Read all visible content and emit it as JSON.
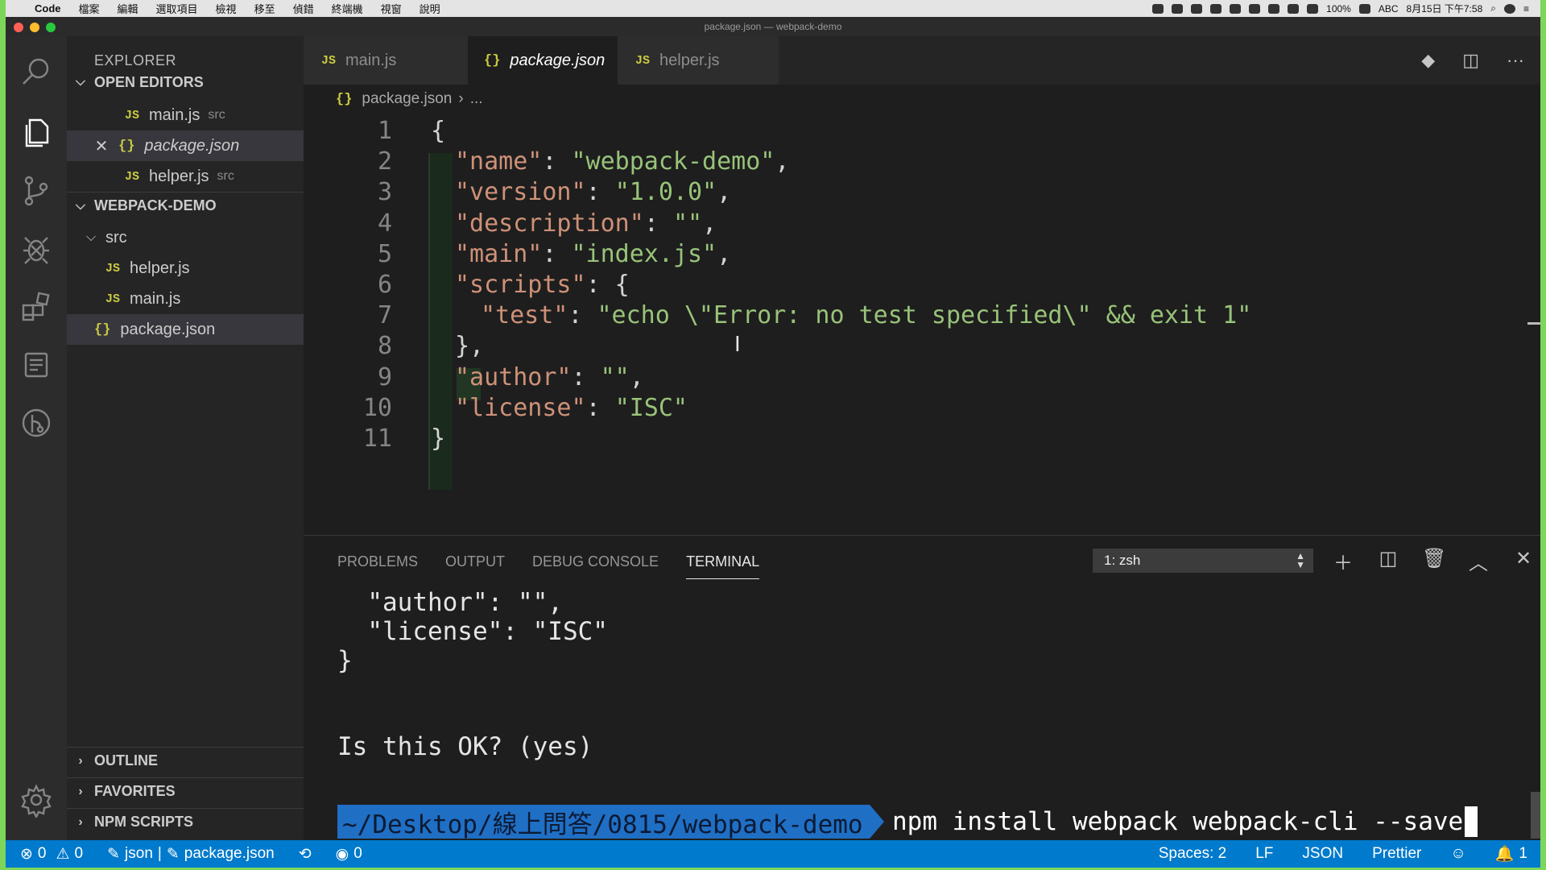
{
  "menubar": {
    "apple": "",
    "items": [
      "Code",
      "檔案",
      "編輯",
      "選取項目",
      "檢視",
      "移至",
      "偵錯",
      "終端機",
      "視窗",
      "說明"
    ],
    "battery": "100%",
    "input": "ABC",
    "datetime": "8月15日 下午7:58"
  },
  "window": {
    "title": "package.json — webpack-demo"
  },
  "sidebar": {
    "title": "EXPLORER",
    "open_editors": {
      "header": "OPEN EDITORS",
      "items": [
        {
          "icon": "JS",
          "name": "main.js",
          "hint": "src"
        },
        {
          "icon": "{}",
          "name": "package.json",
          "hint": ""
        },
        {
          "icon": "JS",
          "name": "helper.js",
          "hint": "src"
        }
      ]
    },
    "project": {
      "header": "WEBPACK-DEMO",
      "folder": "src",
      "files": [
        {
          "icon": "JS",
          "name": "helper.js"
        },
        {
          "icon": "JS",
          "name": "main.js"
        },
        {
          "icon": "{}",
          "name": "package.json"
        }
      ]
    },
    "bottom_sections": [
      "OUTLINE",
      "FAVORITES",
      "NPM SCRIPTS"
    ]
  },
  "tabs": [
    {
      "icon": "JS",
      "label": "main.js",
      "active": false
    },
    {
      "icon": "{}",
      "label": "package.json",
      "active": true
    },
    {
      "icon": "JS",
      "label": "helper.js",
      "active": false
    }
  ],
  "breadcrumb": {
    "icon": "{}",
    "file": "package.json",
    "rest": "..."
  },
  "editor": {
    "line_numbers": [
      "1",
      "2",
      "3",
      "4",
      "5",
      "6",
      "7",
      "8",
      "9",
      "10",
      "11"
    ],
    "lines": [
      {
        "parts": [
          [
            "p",
            "{"
          ]
        ]
      },
      {
        "parts": [
          [
            "k",
            "\"name\""
          ],
          [
            "p",
            ": "
          ],
          [
            "s",
            "\"webpack-demo\""
          ],
          [
            "p",
            ","
          ]
        ]
      },
      {
        "parts": [
          [
            "k",
            "\"version\""
          ],
          [
            "p",
            ": "
          ],
          [
            "s",
            "\"1.0.0\""
          ],
          [
            "p",
            ","
          ]
        ]
      },
      {
        "parts": [
          [
            "k",
            "\"description\""
          ],
          [
            "p",
            ": "
          ],
          [
            "s",
            "\"\""
          ],
          [
            "p",
            ","
          ]
        ]
      },
      {
        "parts": [
          [
            "k",
            "\"main\""
          ],
          [
            "p",
            ": "
          ],
          [
            "s",
            "\"index.js\""
          ],
          [
            "p",
            ","
          ]
        ]
      },
      {
        "parts": [
          [
            "k",
            "\"scripts\""
          ],
          [
            "p",
            ": {"
          ]
        ]
      },
      {
        "parts": [
          [
            "k",
            "\"test\""
          ],
          [
            "p",
            ": "
          ],
          [
            "s",
            "\"echo \\\"Error: no test specified\\\" && exit 1\""
          ]
        ]
      },
      {
        "parts": [
          [
            "p",
            "},"
          ]
        ]
      },
      {
        "parts": [
          [
            "k",
            "\"author\""
          ],
          [
            "p",
            ": "
          ],
          [
            "s",
            "\"\""
          ],
          [
            "p",
            ","
          ]
        ]
      },
      {
        "parts": [
          [
            "k",
            "\"license\""
          ],
          [
            "p",
            ": "
          ],
          [
            "s",
            "\"ISC\""
          ]
        ]
      },
      {
        "parts": [
          [
            "p",
            "}"
          ]
        ]
      }
    ]
  },
  "panel": {
    "tabs": [
      "PROBLEMS",
      "OUTPUT",
      "DEBUG CONSOLE",
      "TERMINAL"
    ],
    "active_tab": "TERMINAL",
    "shell": "1: zsh",
    "terminal_lines": [
      "  \"author\": \"\",",
      "  \"license\": \"ISC\"",
      "}",
      "",
      "Is this OK? (yes)"
    ],
    "prompt_path": "~/Desktop/線上問答/0815/webpack-demo",
    "command": "npm install webpack webpack-cli --save"
  },
  "status": {
    "errors": "0",
    "warnings": "0",
    "language_mode_a": "json",
    "file": "package.json",
    "watch_count": "0",
    "spaces": "Spaces: 2",
    "eol": "LF",
    "language": "JSON",
    "formatter": "Prettier",
    "notifications": "1"
  },
  "colors": {
    "status_bar": "#007acc",
    "json_key": "#ce9178",
    "json_string": "#98c379",
    "js_icon": "#cbcb41"
  }
}
